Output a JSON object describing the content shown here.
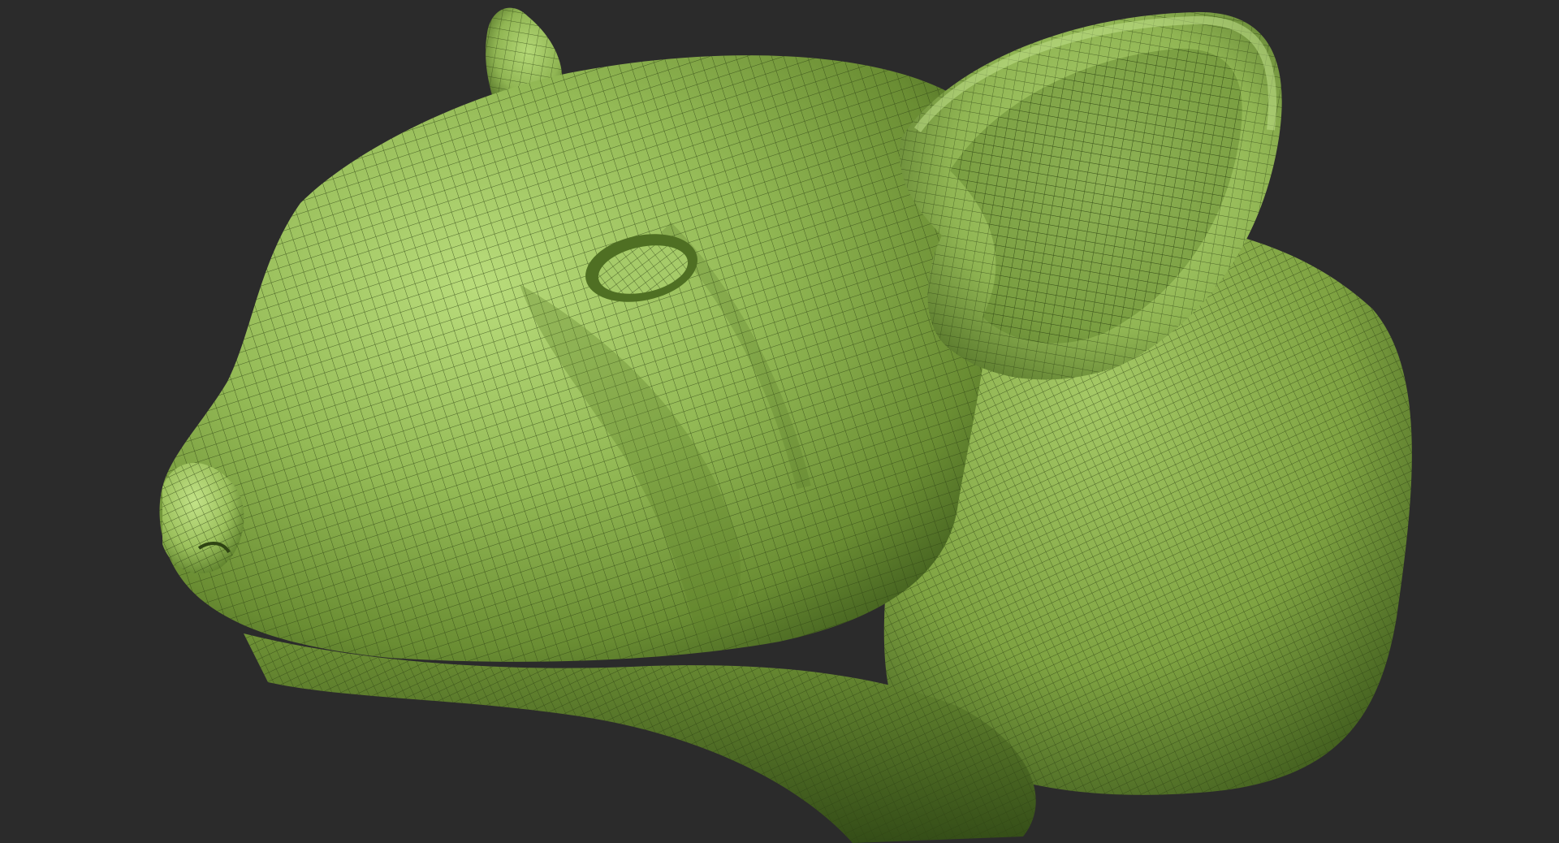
{
  "viewport": {
    "background_color": "#2b2b2b",
    "subject": "rat-head-sculpt",
    "mesh_color": "#8fb44e",
    "mesh_highlight": "#b5d977",
    "mesh_shadow": "#3e5a1c",
    "wire_color": "#2f4414"
  }
}
